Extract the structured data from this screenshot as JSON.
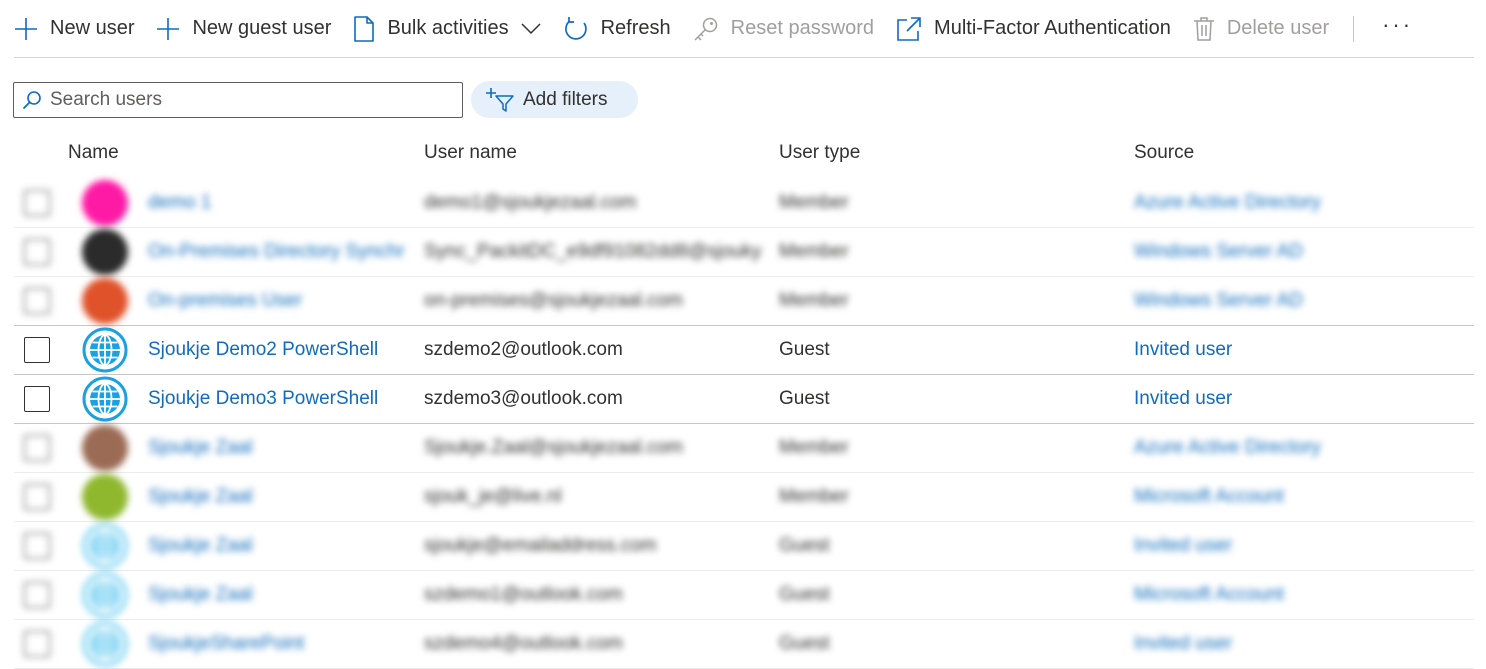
{
  "toolbar": {
    "new_user": "New user",
    "new_guest_user": "New guest user",
    "bulk_activities": "Bulk activities",
    "refresh": "Refresh",
    "reset_password": "Reset password",
    "mfa": "Multi-Factor Authentication",
    "delete_user": "Delete user",
    "more": "···"
  },
  "search": {
    "placeholder": "Search users"
  },
  "filters": {
    "label": "Add filters"
  },
  "columns": {
    "name": "Name",
    "user_name": "User name",
    "user_type": "User type",
    "source": "Source"
  },
  "colors": {
    "link": "#0f6cbd",
    "globe": "#1ba1e2",
    "filter_pill_bg": "#e6f0fa"
  },
  "rows": [
    {
      "name": "demo 1",
      "user_name": "demo1@sjoukjezaal.com",
      "user_type": "Member",
      "source": "Azure Active Directory",
      "avatar": "initials",
      "avatar_color": "#ff1aa6",
      "blurred": true
    },
    {
      "name": "On-Premises Directory Synchr",
      "user_name": "Sync_PackitDC_e9df91082dd8@sjouky...",
      "user_type": "Member",
      "source": "Windows Server AD",
      "avatar": "initials",
      "avatar_color": "#2b2b2b",
      "blurred": true
    },
    {
      "name": "On-premises User",
      "user_name": "on-premises@sjoukjezaal.com",
      "user_type": "Member",
      "source": "Windows Server AD",
      "avatar": "initials",
      "avatar_color": "#e0522a",
      "blurred": true
    },
    {
      "name": "Sjoukje Demo2 PowerShell",
      "user_name": "szdemo2@outlook.com",
      "user_type": "Guest",
      "source": "Invited user",
      "avatar": "globe-icon",
      "blurred": false
    },
    {
      "name": "Sjoukje Demo3 PowerShell",
      "user_name": "szdemo3@outlook.com",
      "user_type": "Guest",
      "source": "Invited user",
      "avatar": "globe-icon",
      "blurred": false
    },
    {
      "name": "Sjoukje Zaal",
      "user_name": "Sjoukje.Zaal@sjoukjezaal.com",
      "user_type": "Member",
      "source": "Azure Active Directory",
      "avatar": "photo",
      "avatar_color": "#9b6b55",
      "blurred": true
    },
    {
      "name": "Sjoukje Zaal",
      "user_name": "sjouk_je@live.nl",
      "user_type": "Member",
      "source": "Microsoft Account",
      "avatar": "initials",
      "avatar_color": "#8fb82e",
      "blurred": true
    },
    {
      "name": "Sjoukje Zaal",
      "user_name": "sjoukje@emailaddress.com",
      "user_type": "Guest",
      "source": "Invited user",
      "avatar": "globe-icon",
      "avatar_color": "#5cc8f0",
      "blurred": true
    },
    {
      "name": "Sjoukje Zaal",
      "user_name": "szdemo1@outlook.com",
      "user_type": "Guest",
      "source": "Microsoft Account",
      "avatar": "globe-icon",
      "avatar_color": "#5cc8f0",
      "blurred": true
    },
    {
      "name": "SjoukjeSharePoint",
      "user_name": "szdemo4@outlook.com",
      "user_type": "Guest",
      "source": "Invited user",
      "avatar": "globe-icon",
      "avatar_color": "#5cc8f0",
      "blurred": true
    }
  ]
}
